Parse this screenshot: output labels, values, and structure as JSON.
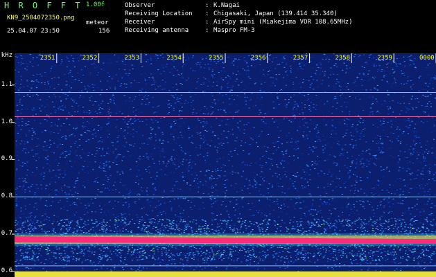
{
  "header": {
    "app_name": "H R O F F T",
    "version": "1.00f",
    "filename": "KN9_2504072350.png",
    "mode_label": "meteor",
    "datetime": "25.04.07 23:50",
    "count": "156",
    "info_rows": [
      {
        "label": "Observer",
        "sep": ":",
        "value": "K.Nagai"
      },
      {
        "label": "Receiving Location",
        "sep": ":",
        "value": "Chigasaki, Japan (139.414 35.340)"
      },
      {
        "label": "Receiver",
        "sep": ":",
        "value": "AirSpy mini (Miakejima VOR 108.65MHz)"
      },
      {
        "label": "Receiving antenna",
        "sep": ":",
        "value": "Maspro FM-3"
      }
    ]
  },
  "spectrogram": {
    "y_unit": "kHz",
    "y_ticks": [
      "1.1",
      "1.0",
      "0.9",
      "0.8",
      "0.7",
      "0.6"
    ],
    "y_range_khz": [
      0.585,
      1.185
    ],
    "time_markers": [
      "2351",
      "2352",
      "2353",
      "2354",
      "2355",
      "2356",
      "2357",
      "2358",
      "2359",
      "0000"
    ],
    "signal_khz": 0.685,
    "lines_khz": [
      1.08,
      1.015,
      0.8,
      0.615
    ],
    "colors": {
      "background": "#000000",
      "noise_low": "#0a2a8a",
      "noise_high": "#2a80ff",
      "signal": "#ff2a7a",
      "marker_text": "#ffff00",
      "title": "#66ff66"
    }
  }
}
